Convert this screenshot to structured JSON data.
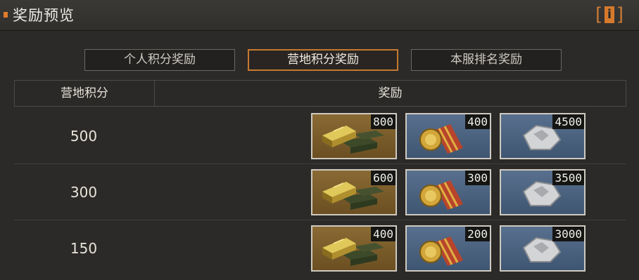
{
  "window": {
    "title": "奖励预览"
  },
  "tabs": [
    {
      "label": "个人积分奖励",
      "active": false
    },
    {
      "label": "营地积分奖励",
      "active": true
    },
    {
      "label": "本服排名奖励",
      "active": false
    }
  ],
  "table": {
    "headers": [
      "营地积分",
      "奖励"
    ],
    "rows": [
      {
        "score": "500",
        "rewards": [
          {
            "icon": "gold-bars-icon",
            "count": "800"
          },
          {
            "icon": "medal-icon",
            "count": "400"
          },
          {
            "icon": "silver-ore-icon",
            "count": "4500"
          }
        ]
      },
      {
        "score": "300",
        "rewards": [
          {
            "icon": "gold-bars-icon",
            "count": "600"
          },
          {
            "icon": "medal-icon",
            "count": "300"
          },
          {
            "icon": "silver-ore-icon",
            "count": "3500"
          }
        ]
      },
      {
        "score": "150",
        "rewards": [
          {
            "icon": "gold-bars-icon",
            "count": "400"
          },
          {
            "icon": "medal-icon",
            "count": "200"
          },
          {
            "icon": "silver-ore-icon",
            "count": "3000"
          }
        ]
      }
    ]
  },
  "colors": {
    "accent": "#d67a2c",
    "background": "#2b2a28",
    "tab_active_border": "#c8782f"
  }
}
